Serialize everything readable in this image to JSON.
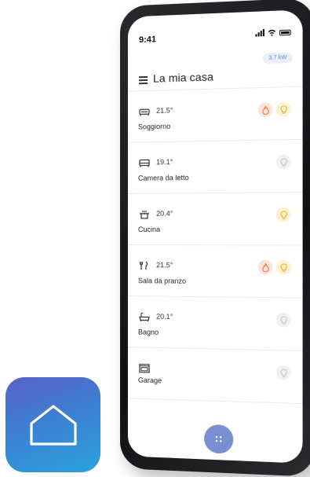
{
  "statusbar": {
    "time": "9:41"
  },
  "header": {
    "title": "La mia casa",
    "power": "3.7 kW"
  },
  "rooms": [
    {
      "name": "Soggiorno",
      "temp": "21.5°",
      "icon": "sofa-icon",
      "heating": true,
      "light_on": true
    },
    {
      "name": "Camera da letto",
      "temp": "19.1°",
      "icon": "bed-icon",
      "heating": false,
      "light_on": false
    },
    {
      "name": "Cucina",
      "temp": "20.4°",
      "icon": "pot-icon",
      "heating": false,
      "light_on": true
    },
    {
      "name": "Sala da pranzo",
      "temp": "21.5°",
      "icon": "cutlery-icon",
      "heating": true,
      "light_on": true
    },
    {
      "name": "Bagno",
      "temp": "20.1°",
      "icon": "bathtub-icon",
      "heating": false,
      "light_on": false
    },
    {
      "name": "Garage",
      "temp": "",
      "icon": "garage-icon",
      "heating": false,
      "light_on": false
    }
  ],
  "colors": {
    "accent": "#7a8fd0",
    "flame": "#e07a4a",
    "bulb_on": "#f0b429",
    "bulb_off": "#c9c9c9",
    "tile_gradient_start": "#5b62c6",
    "tile_gradient_end": "#2aa3dc"
  },
  "fab": {
    "icon": "dots-grid-icon"
  },
  "app_icon": {
    "icon": "home-outline-icon"
  }
}
